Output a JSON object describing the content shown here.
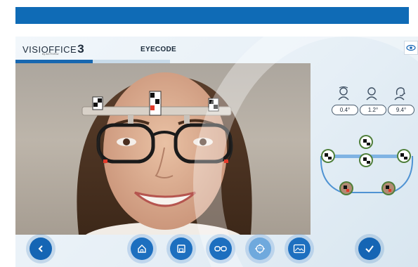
{
  "app": {
    "logo_text": "VISIOFFICE",
    "logo_number": "3",
    "logo_sub": "by ACTIVISU",
    "screen_title": "EYECODE",
    "progress_fraction": 0.5
  },
  "measurements": [
    {
      "icon": "head-tilt-icon",
      "value": "0.4°"
    },
    {
      "icon": "head-front-icon",
      "value": "1.2°"
    },
    {
      "icon": "head-turn-icon",
      "value": "9.4°"
    }
  ],
  "footer": {
    "back_icon": "chevron-left-icon",
    "tools": [
      "home-icon",
      "save-icon",
      "glasses-icon",
      "face-target-icon",
      "image-card-icon"
    ],
    "confirm_icon": "check-icon"
  },
  "colors": {
    "top_band": "#0f6bb6",
    "primary": "#1565b4",
    "active_tool": "#6fa9dd",
    "pill_border": "#4a5c6e",
    "clip_bar": "#d8d1c8",
    "marker_red": "#e23a2a"
  }
}
